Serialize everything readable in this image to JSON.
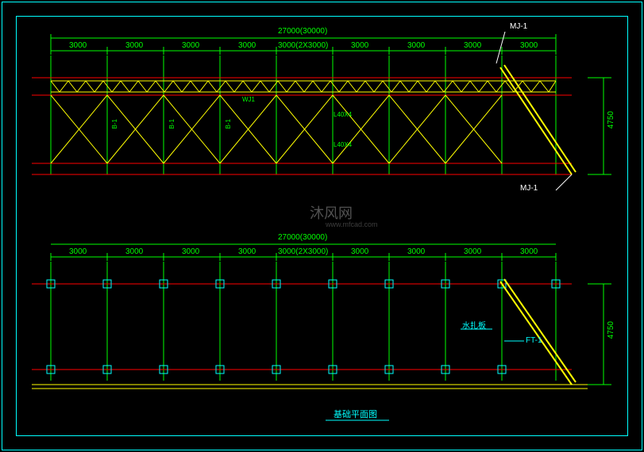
{
  "dims": {
    "total_top": "27000(30000)",
    "spans": [
      "3000",
      "3000",
      "3000",
      "3000",
      "3000(2X3000)",
      "3000",
      "3000",
      "3000",
      "3000"
    ],
    "height": "4750",
    "total_bot": "27000(30000)",
    "spans_bot": [
      "3000",
      "3000",
      "3000",
      "3000",
      "3000(2X3000)",
      "3000",
      "3000",
      "3000",
      "3000"
    ],
    "height_bot": "4750"
  },
  "labels": {
    "mj1_top": "MJ-1",
    "mj1_bot": "MJ-1",
    "wj1": "WJ1",
    "b1a": "B-1",
    "b1b": "B-1",
    "b1c": "B-1",
    "l40x4a": "L40X4",
    "l40x4b": "L40X4",
    "ft1": "FT-1",
    "water": "水扎板",
    "title": "基础平面图"
  },
  "watermark": {
    "main": "沐风网",
    "url": "www.mfcad.com"
  }
}
